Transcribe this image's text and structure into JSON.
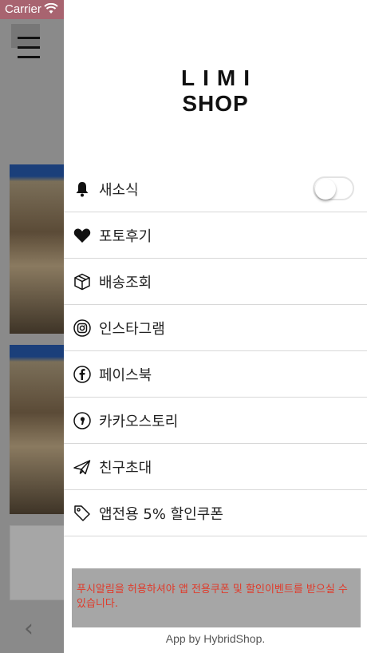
{
  "status_bar": {
    "carrier": "Carrier"
  },
  "drawer": {
    "logo": {
      "line1": "LIMI",
      "line2": "SHOP"
    },
    "menu": [
      {
        "label": "새소식",
        "icon": "bell-icon",
        "toggle": false
      },
      {
        "label": "포토후기",
        "icon": "heart-icon"
      },
      {
        "label": "배송조회",
        "icon": "box-icon"
      },
      {
        "label": "인스타그램",
        "icon": "instagram-icon"
      },
      {
        "label": "페이스북",
        "icon": "facebook-icon"
      },
      {
        "label": "카카오스토리",
        "icon": "kakaostory-icon"
      },
      {
        "label": "친구초대",
        "icon": "paper-plane-icon"
      },
      {
        "label": "앱전용 5% 할인쿠폰",
        "icon": "tag-icon"
      }
    ],
    "notice": "푸시알림을 허용하셔야 앱 전용쿠폰 및 할인이벤트를 받으실 수 있습니다.",
    "footer": "App by HybridShop."
  },
  "colors": {
    "status_bar": "#a86470",
    "notice_text": "#e03a2a",
    "notice_bg": "#a6a6a6"
  }
}
